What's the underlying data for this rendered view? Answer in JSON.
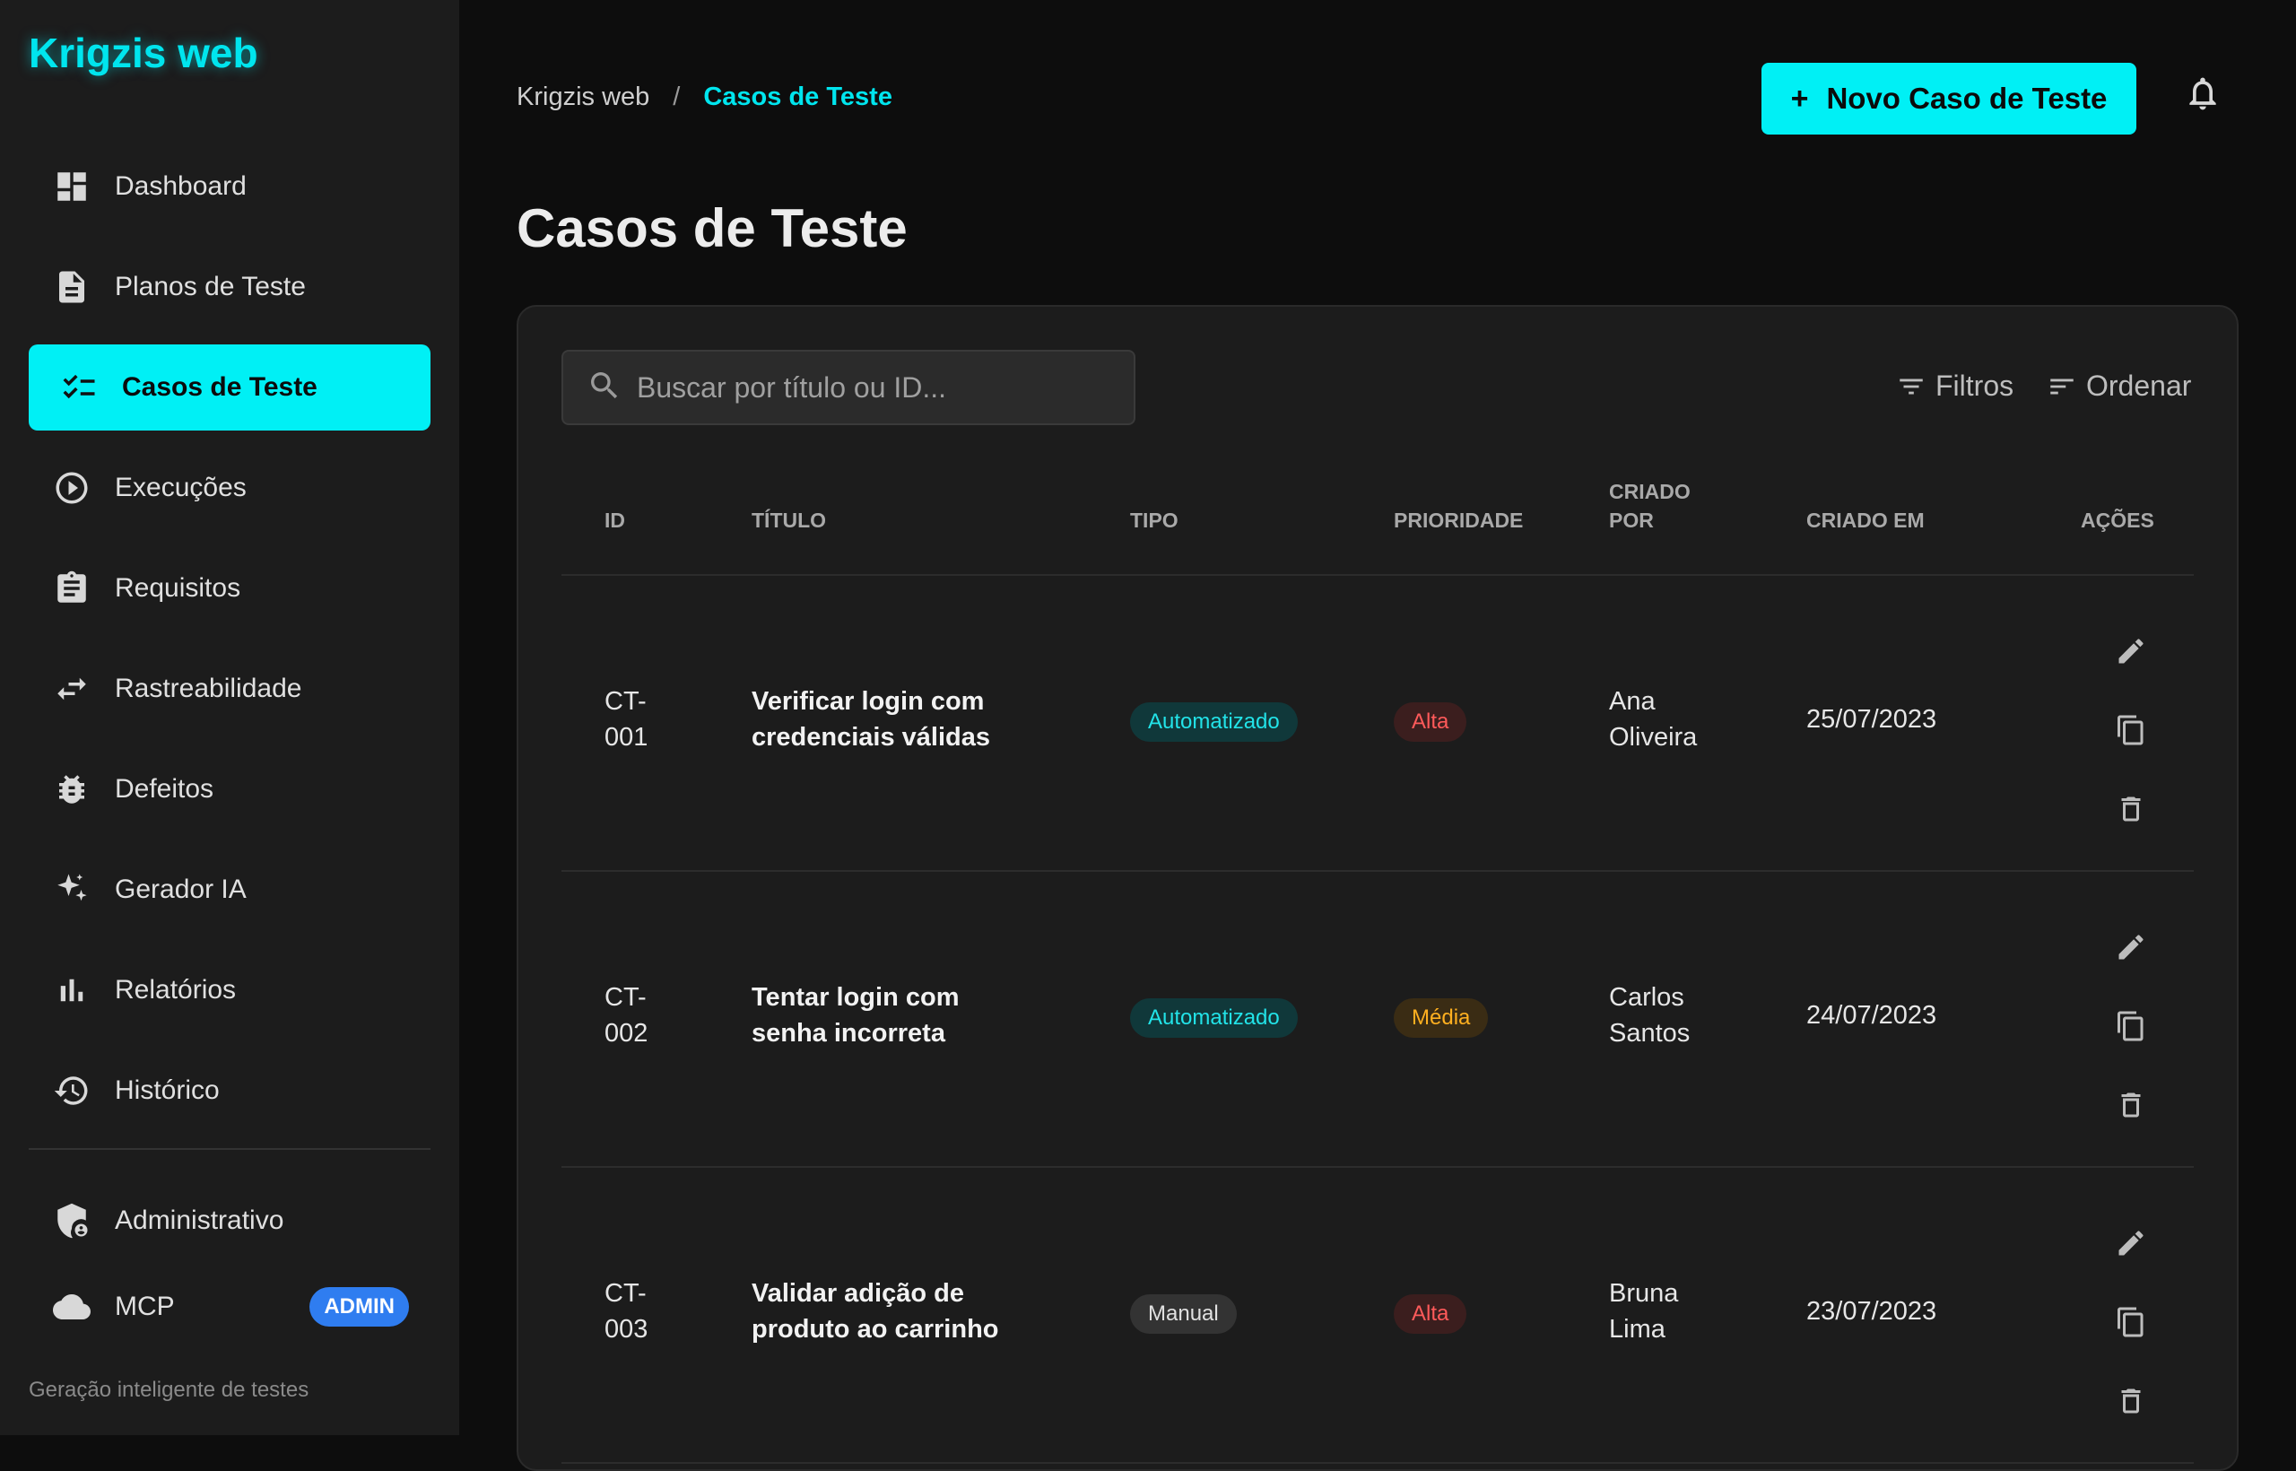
{
  "app": {
    "name": "Krigzis web",
    "tagline": "Geração inteligente de testes"
  },
  "sidebar": {
    "items": [
      {
        "label": "Dashboard",
        "icon": "dashboard-icon"
      },
      {
        "label": "Planos de Teste",
        "icon": "document-icon"
      },
      {
        "label": "Casos de Teste",
        "icon": "checklist-icon",
        "active": true
      },
      {
        "label": "Execuções",
        "icon": "play-circle-icon"
      },
      {
        "label": "Requisitos",
        "icon": "clipboard-icon"
      },
      {
        "label": "Rastreabilidade",
        "icon": "swap-arrows-icon"
      },
      {
        "label": "Defeitos",
        "icon": "bug-icon"
      },
      {
        "label": "Gerador IA",
        "icon": "sparkle-icon"
      },
      {
        "label": "Relatórios",
        "icon": "bar-chart-icon"
      },
      {
        "label": "Histórico",
        "icon": "history-icon"
      }
    ],
    "admin_items": [
      {
        "label": "Administrativo",
        "icon": "shield-user-icon"
      },
      {
        "label": "MCP",
        "icon": "cloud-icon",
        "badge": "ADMIN"
      }
    ]
  },
  "header": {
    "breadcrumb": {
      "root": "Krigzis web",
      "separator": "/",
      "current": "Casos de Teste"
    },
    "new_button_label": "Novo Caso de Teste"
  },
  "page": {
    "title": "Casos de Teste"
  },
  "toolbar": {
    "search_placeholder": "Buscar por título ou ID...",
    "filters_label": "Filtros",
    "sort_label": "Ordenar"
  },
  "table": {
    "columns": {
      "id": "ID",
      "title": "TÍTULO",
      "type": "TIPO",
      "priority": "PRIORIDADE",
      "created_by_1": "CRIADO",
      "created_by_2": "POR",
      "created_at": "CRIADO EM",
      "actions": "AÇÕES"
    },
    "rows": [
      {
        "id_1": "CT-",
        "id_2": "001",
        "title_1": "Verificar login com",
        "title_2": "credenciais válidas",
        "type": "Automatizado",
        "priority": "Alta",
        "by_1": "Ana",
        "by_2": "Oliveira",
        "date": "25/07/2023"
      },
      {
        "id_1": "CT-",
        "id_2": "002",
        "title_1": "Tentar login com",
        "title_2": "senha incorreta",
        "type": "Automatizado",
        "priority": "Média",
        "by_1": "Carlos",
        "by_2": "Santos",
        "date": "24/07/2023"
      },
      {
        "id_1": "CT-",
        "id_2": "003",
        "title_1": "Validar adição de",
        "title_2": "produto ao carrinho",
        "type": "Manual",
        "priority": "Alta",
        "by_1": "Bruna",
        "by_2": "Lima",
        "date": "23/07/2023"
      }
    ]
  },
  "colors": {
    "accent": "#00f0f5",
    "background": "#0d0d0d",
    "panel": "#1c1c1c",
    "admin_badge": "#2f7df0"
  }
}
